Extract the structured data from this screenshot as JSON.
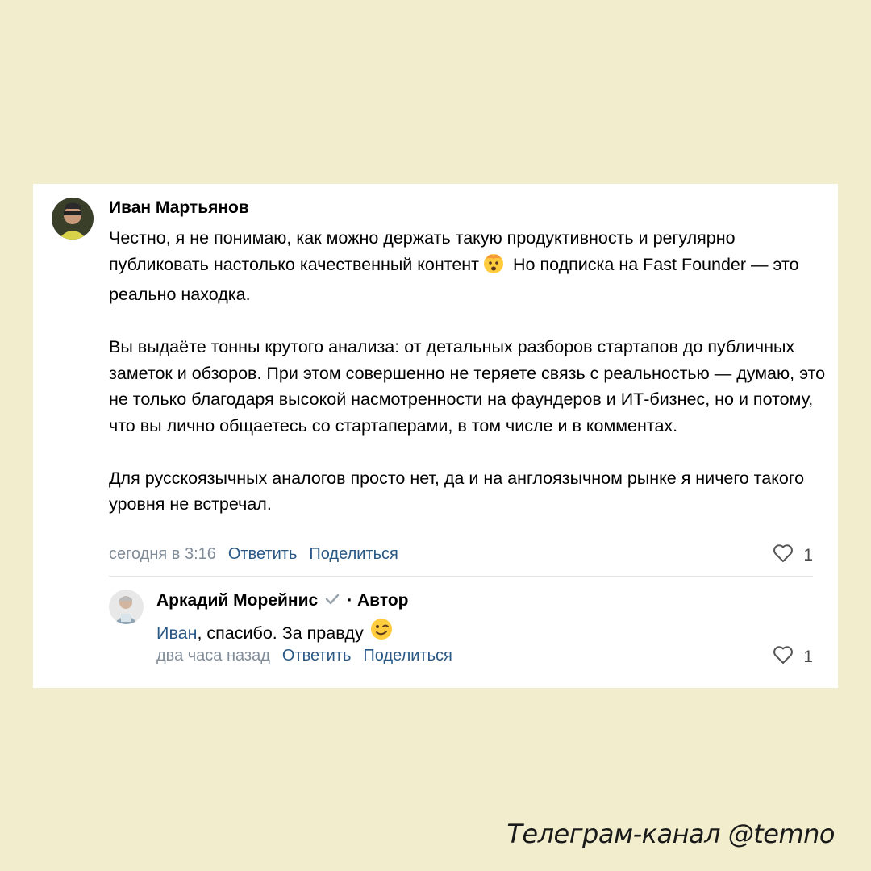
{
  "comment": {
    "author": "Иван Мартьянов",
    "paragraphs": [
      "Честно, я не понимаю, как можно держать такую продуктивность и регулярно публиковать настолько качественный контент",
      "Но подписка на Fast Founder — это реально находка.",
      "Вы выдаёте тонны крутого анализа: от детальных разборов стартапов до публичных заметок и обзоров. При этом совершенно не теряете связь с реальностью — думаю, это не только благодаря высокой насмотренности на фаундеров и ИТ-бизнес, но и потому, что вы лично общаетесь со стартаперами, в том числе и в комментах.",
      "Для русскоязычных аналогов просто нет, да и на англоязычном рынке я ничего такого уровня не встречал."
    ],
    "emoji_icon": "exploding-head-emoji",
    "time": "сегодня в 3:16",
    "reply_label": "Ответить",
    "share_label": "Поделиться",
    "likes": "1"
  },
  "reply": {
    "author": "Аркадий Морейнис",
    "role": "· Автор",
    "mention": "Иван",
    "text": ", спасибо. За правду",
    "emoji_icon": "winking-face-emoji",
    "time": "два часа назад",
    "reply_label": "Ответить",
    "share_label": "Поделиться",
    "likes": "1"
  },
  "watermark": "Телеграм-канал @temno",
  "colors": {
    "background": "#f2edcc",
    "link": "#2a5885",
    "meta_gray": "#818c99"
  }
}
